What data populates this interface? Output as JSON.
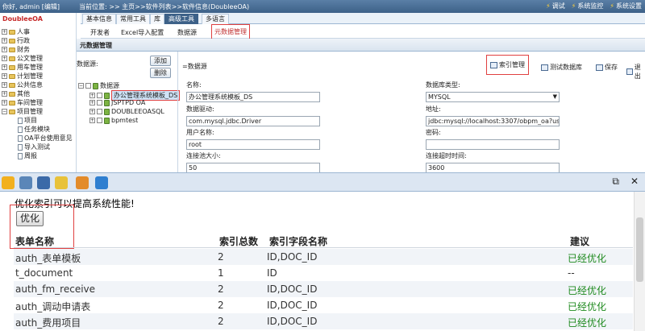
{
  "topbar": {
    "user": "你好, admin [编辑]",
    "location": "当前位置: >> 主页>>软件列表>>软件信息(DoubleeOA)",
    "actions": [
      "调试",
      "系统监控",
      "系统设置"
    ]
  },
  "menu": {
    "tabs": [
      "基本信息",
      "常用工具",
      "库",
      "高级工具",
      "多语言"
    ],
    "active_index": 3
  },
  "submenu": {
    "items": [
      "开发者",
      "Excel导入配置",
      "数据源",
      "元数据管理"
    ],
    "highlight_index": 3
  },
  "sidebar": {
    "brand": "DoubleeOA",
    "items": [
      "人事",
      "行政",
      "财务",
      "公文管理",
      "用车管理",
      "计划管理",
      "公共信息",
      "其他",
      "车间管理",
      "项目管理"
    ],
    "subitems": [
      "项目",
      "任务模块",
      "OA平台使用意见",
      "导入测试",
      "周报"
    ]
  },
  "panel": {
    "title": "元数据管理",
    "datasource_label": "数据源:",
    "add_label": "添加",
    "delete_label": "删除",
    "tree_root": "数据源",
    "tree_items": [
      "办公管理系统模板_DS",
      "JSPTPD OA",
      "DOUBLEEOASQL",
      "bpmtest"
    ]
  },
  "right": {
    "section_title": "=数据源",
    "buttons": [
      "索引管理",
      "测试数据库",
      "保存",
      "退出"
    ],
    "fields": {
      "name_label": "名称:",
      "name_value": "办公管理系统模板_DS",
      "dbtype_label": "数据库类型:",
      "dbtype_value": "MYSQL",
      "driver_label": "数据驱动:",
      "driver_value": "com.mysql.jdbc.Driver",
      "url_label": "地址:",
      "url_value": "jdbc:mysql://localhost:3307/obpm_oa?useUnic",
      "user_label": "用户名称:",
      "user_value": "root",
      "pwd_label": "密码:",
      "pwd_value": "",
      "pool_label": "连接池大小:",
      "pool_value": "50",
      "timeout_label": "连接超时时间:",
      "timeout_value": "3600"
    }
  },
  "overlay": {
    "hint": "优化索引可以提高系统性能!",
    "optimize_label": "优化",
    "headers": [
      "表单名称",
      "索引总数",
      "索引字段名称",
      "建议"
    ],
    "rows": [
      {
        "name": "auth_表单模板",
        "count": "2",
        "fields": "ID,DOC_ID",
        "advice": "已经优化"
      },
      {
        "name": "t_document",
        "count": "1",
        "fields": "ID",
        "advice": "--"
      },
      {
        "name": "auth_fm_receive",
        "count": "2",
        "fields": "ID,DOC_ID",
        "advice": "已经优化"
      },
      {
        "name": "auth_调动申请表",
        "count": "2",
        "fields": "ID,DOC_ID",
        "advice": "已经优化"
      },
      {
        "name": "auth_费用项目",
        "count": "2",
        "fields": "ID,DOC_ID",
        "advice": "已经优化"
      }
    ]
  },
  "colors": {
    "accent": "#3d6188",
    "highlight_red": "#e04040",
    "success_green": "#1e8a1e"
  }
}
